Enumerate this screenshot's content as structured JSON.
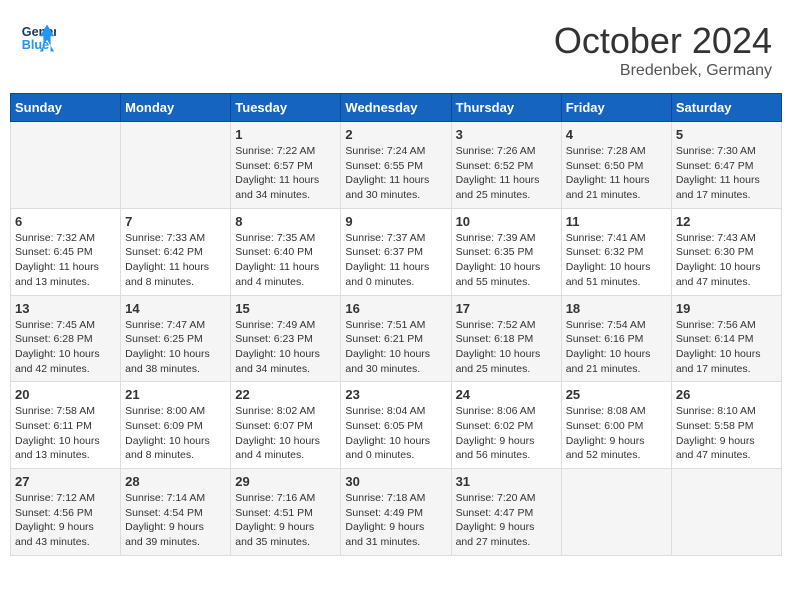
{
  "header": {
    "logo_line1": "General",
    "logo_line2": "Blue",
    "month": "October 2024",
    "location": "Bredenbek, Germany"
  },
  "days_of_week": [
    "Sunday",
    "Monday",
    "Tuesday",
    "Wednesday",
    "Thursday",
    "Friday",
    "Saturday"
  ],
  "weeks": [
    [
      {
        "day": "",
        "info": ""
      },
      {
        "day": "",
        "info": ""
      },
      {
        "day": "1",
        "info": "Sunrise: 7:22 AM\nSunset: 6:57 PM\nDaylight: 11 hours\nand 34 minutes."
      },
      {
        "day": "2",
        "info": "Sunrise: 7:24 AM\nSunset: 6:55 PM\nDaylight: 11 hours\nand 30 minutes."
      },
      {
        "day": "3",
        "info": "Sunrise: 7:26 AM\nSunset: 6:52 PM\nDaylight: 11 hours\nand 25 minutes."
      },
      {
        "day": "4",
        "info": "Sunrise: 7:28 AM\nSunset: 6:50 PM\nDaylight: 11 hours\nand 21 minutes."
      },
      {
        "day": "5",
        "info": "Sunrise: 7:30 AM\nSunset: 6:47 PM\nDaylight: 11 hours\nand 17 minutes."
      }
    ],
    [
      {
        "day": "6",
        "info": "Sunrise: 7:32 AM\nSunset: 6:45 PM\nDaylight: 11 hours\nand 13 minutes."
      },
      {
        "day": "7",
        "info": "Sunrise: 7:33 AM\nSunset: 6:42 PM\nDaylight: 11 hours\nand 8 minutes."
      },
      {
        "day": "8",
        "info": "Sunrise: 7:35 AM\nSunset: 6:40 PM\nDaylight: 11 hours\nand 4 minutes."
      },
      {
        "day": "9",
        "info": "Sunrise: 7:37 AM\nSunset: 6:37 PM\nDaylight: 11 hours\nand 0 minutes."
      },
      {
        "day": "10",
        "info": "Sunrise: 7:39 AM\nSunset: 6:35 PM\nDaylight: 10 hours\nand 55 minutes."
      },
      {
        "day": "11",
        "info": "Sunrise: 7:41 AM\nSunset: 6:32 PM\nDaylight: 10 hours\nand 51 minutes."
      },
      {
        "day": "12",
        "info": "Sunrise: 7:43 AM\nSunset: 6:30 PM\nDaylight: 10 hours\nand 47 minutes."
      }
    ],
    [
      {
        "day": "13",
        "info": "Sunrise: 7:45 AM\nSunset: 6:28 PM\nDaylight: 10 hours\nand 42 minutes."
      },
      {
        "day": "14",
        "info": "Sunrise: 7:47 AM\nSunset: 6:25 PM\nDaylight: 10 hours\nand 38 minutes."
      },
      {
        "day": "15",
        "info": "Sunrise: 7:49 AM\nSunset: 6:23 PM\nDaylight: 10 hours\nand 34 minutes."
      },
      {
        "day": "16",
        "info": "Sunrise: 7:51 AM\nSunset: 6:21 PM\nDaylight: 10 hours\nand 30 minutes."
      },
      {
        "day": "17",
        "info": "Sunrise: 7:52 AM\nSunset: 6:18 PM\nDaylight: 10 hours\nand 25 minutes."
      },
      {
        "day": "18",
        "info": "Sunrise: 7:54 AM\nSunset: 6:16 PM\nDaylight: 10 hours\nand 21 minutes."
      },
      {
        "day": "19",
        "info": "Sunrise: 7:56 AM\nSunset: 6:14 PM\nDaylight: 10 hours\nand 17 minutes."
      }
    ],
    [
      {
        "day": "20",
        "info": "Sunrise: 7:58 AM\nSunset: 6:11 PM\nDaylight: 10 hours\nand 13 minutes."
      },
      {
        "day": "21",
        "info": "Sunrise: 8:00 AM\nSunset: 6:09 PM\nDaylight: 10 hours\nand 8 minutes."
      },
      {
        "day": "22",
        "info": "Sunrise: 8:02 AM\nSunset: 6:07 PM\nDaylight: 10 hours\nand 4 minutes."
      },
      {
        "day": "23",
        "info": "Sunrise: 8:04 AM\nSunset: 6:05 PM\nDaylight: 10 hours\nand 0 minutes."
      },
      {
        "day": "24",
        "info": "Sunrise: 8:06 AM\nSunset: 6:02 PM\nDaylight: 9 hours\nand 56 minutes."
      },
      {
        "day": "25",
        "info": "Sunrise: 8:08 AM\nSunset: 6:00 PM\nDaylight: 9 hours\nand 52 minutes."
      },
      {
        "day": "26",
        "info": "Sunrise: 8:10 AM\nSunset: 5:58 PM\nDaylight: 9 hours\nand 47 minutes."
      }
    ],
    [
      {
        "day": "27",
        "info": "Sunrise: 7:12 AM\nSunset: 4:56 PM\nDaylight: 9 hours\nand 43 minutes."
      },
      {
        "day": "28",
        "info": "Sunrise: 7:14 AM\nSunset: 4:54 PM\nDaylight: 9 hours\nand 39 minutes."
      },
      {
        "day": "29",
        "info": "Sunrise: 7:16 AM\nSunset: 4:51 PM\nDaylight: 9 hours\nand 35 minutes."
      },
      {
        "day": "30",
        "info": "Sunrise: 7:18 AM\nSunset: 4:49 PM\nDaylight: 9 hours\nand 31 minutes."
      },
      {
        "day": "31",
        "info": "Sunrise: 7:20 AM\nSunset: 4:47 PM\nDaylight: 9 hours\nand 27 minutes."
      },
      {
        "day": "",
        "info": ""
      },
      {
        "day": "",
        "info": ""
      }
    ]
  ]
}
